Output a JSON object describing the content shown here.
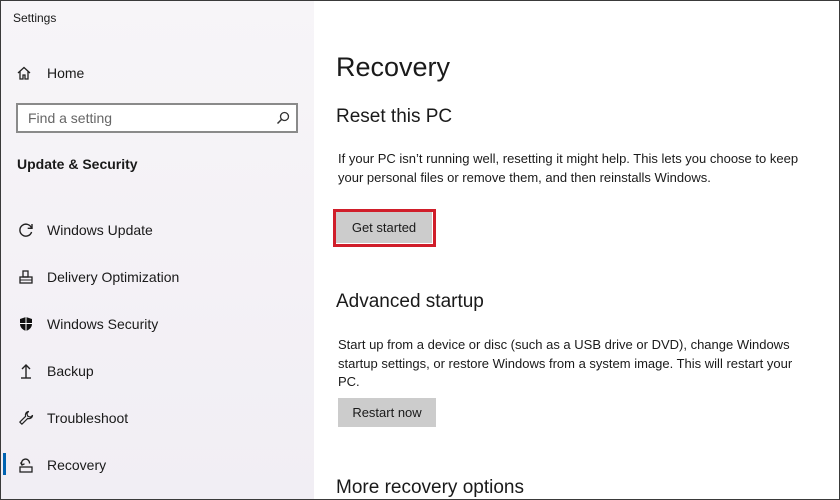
{
  "window": {
    "title": "Settings"
  },
  "sidebar": {
    "home_label": "Home",
    "search_placeholder": "Find a setting",
    "section_heading": "Update & Security",
    "items": [
      {
        "label": "Windows Update",
        "icon": "refresh-icon"
      },
      {
        "label": "Delivery Optimization",
        "icon": "delivery-optimization-icon"
      },
      {
        "label": "Windows Security",
        "icon": "shield-icon"
      },
      {
        "label": "Backup",
        "icon": "backup-arrow-icon"
      },
      {
        "label": "Troubleshoot",
        "icon": "wrench-icon"
      },
      {
        "label": "Recovery",
        "icon": "recovery-icon",
        "active": true
      }
    ]
  },
  "main": {
    "title": "Recovery",
    "reset": {
      "heading": "Reset this PC",
      "description": "If your PC isn’t running well, resetting it might help. This lets you choose to keep your personal files or remove them, and then reinstalls Windows.",
      "button_label": "Get started"
    },
    "advanced": {
      "heading": "Advanced startup",
      "description": "Start up from a device or disc (such as a USB drive or DVD), change Windows startup settings, or restore Windows from a system image. This will restart your PC.",
      "button_label": "Restart now"
    },
    "more": {
      "heading": "More recovery options"
    }
  },
  "colors": {
    "accent": "#0063b1",
    "highlight": "#d01e2a",
    "button": "#cccccc",
    "sidebar_bg": "#f4f1f6"
  }
}
